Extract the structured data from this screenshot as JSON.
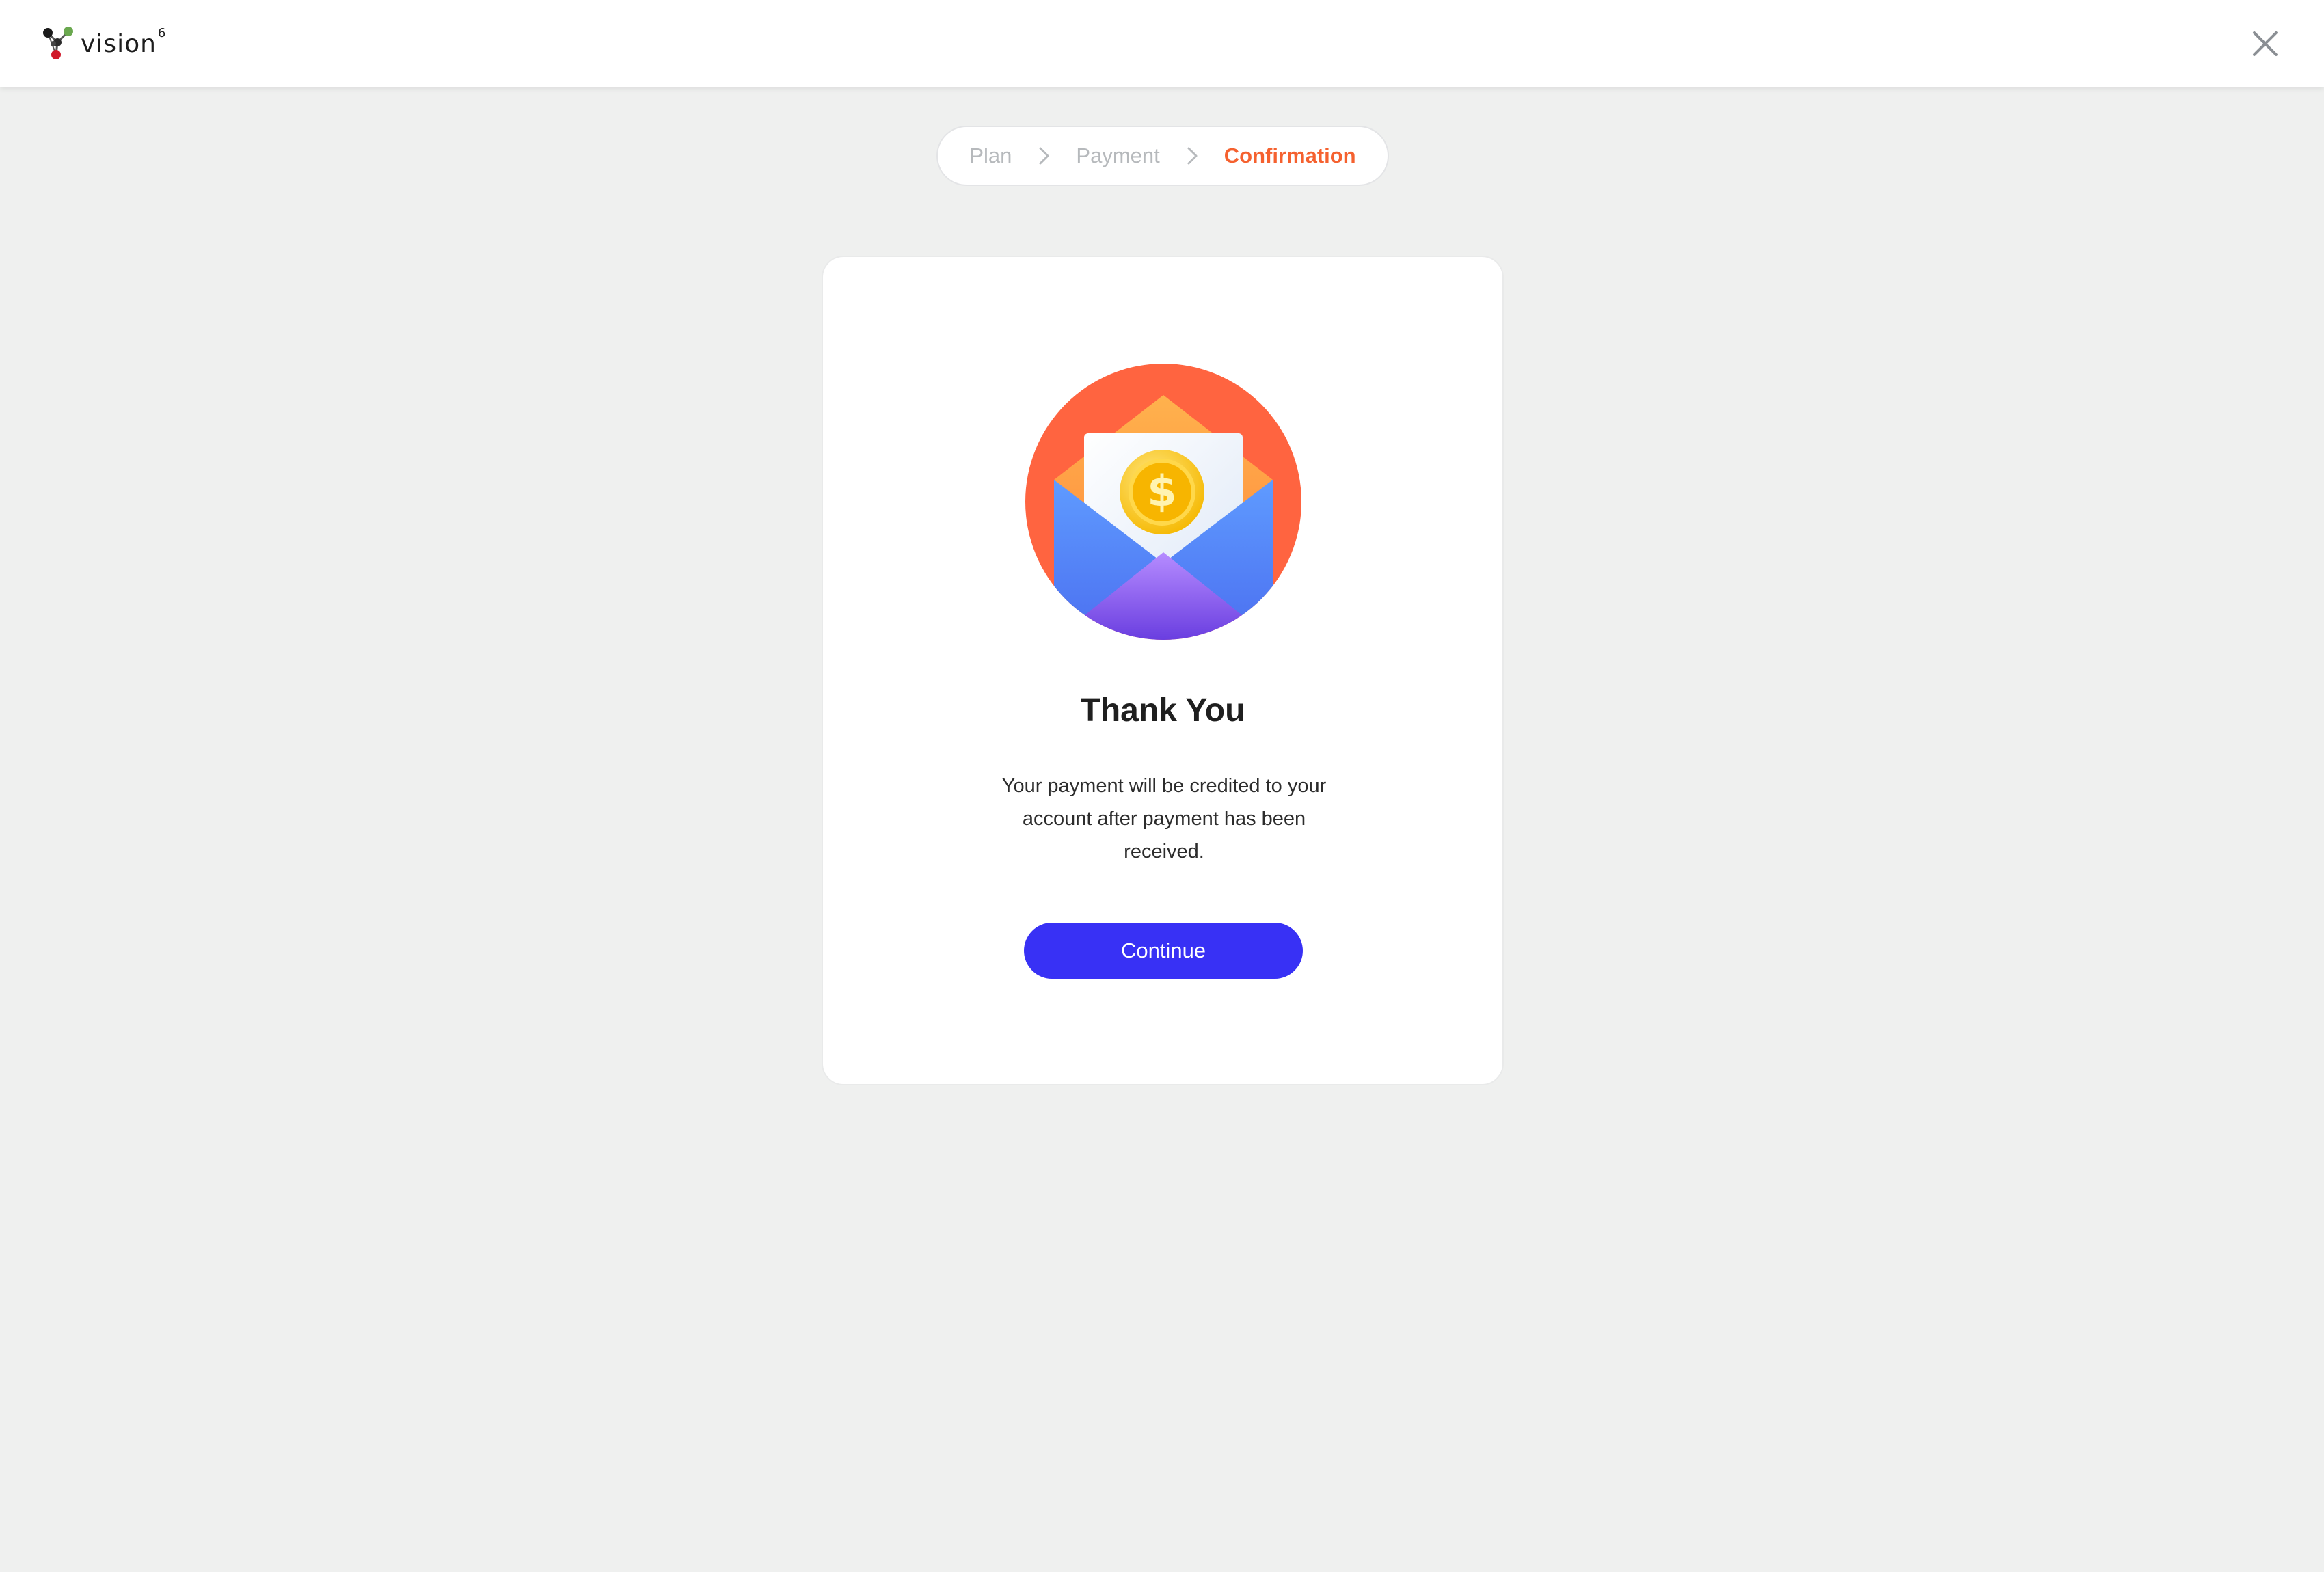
{
  "app": {
    "logo_text": "vision",
    "logo_superscript": "6",
    "close_icon": "close-icon"
  },
  "steps": [
    {
      "label": "Plan",
      "state": "done"
    },
    {
      "label": "Payment",
      "state": "done"
    },
    {
      "label": "Confirmation",
      "state": "active"
    }
  ],
  "confirmation": {
    "illustration": "envelope-coin-icon",
    "title": "Thank You",
    "message": "Your payment will be credited to your account after payment has been received.",
    "continue_label": "Continue"
  },
  "colors": {
    "accent": "#f5612f",
    "primary_button": "#3831f5",
    "background": "#eff0ef"
  }
}
